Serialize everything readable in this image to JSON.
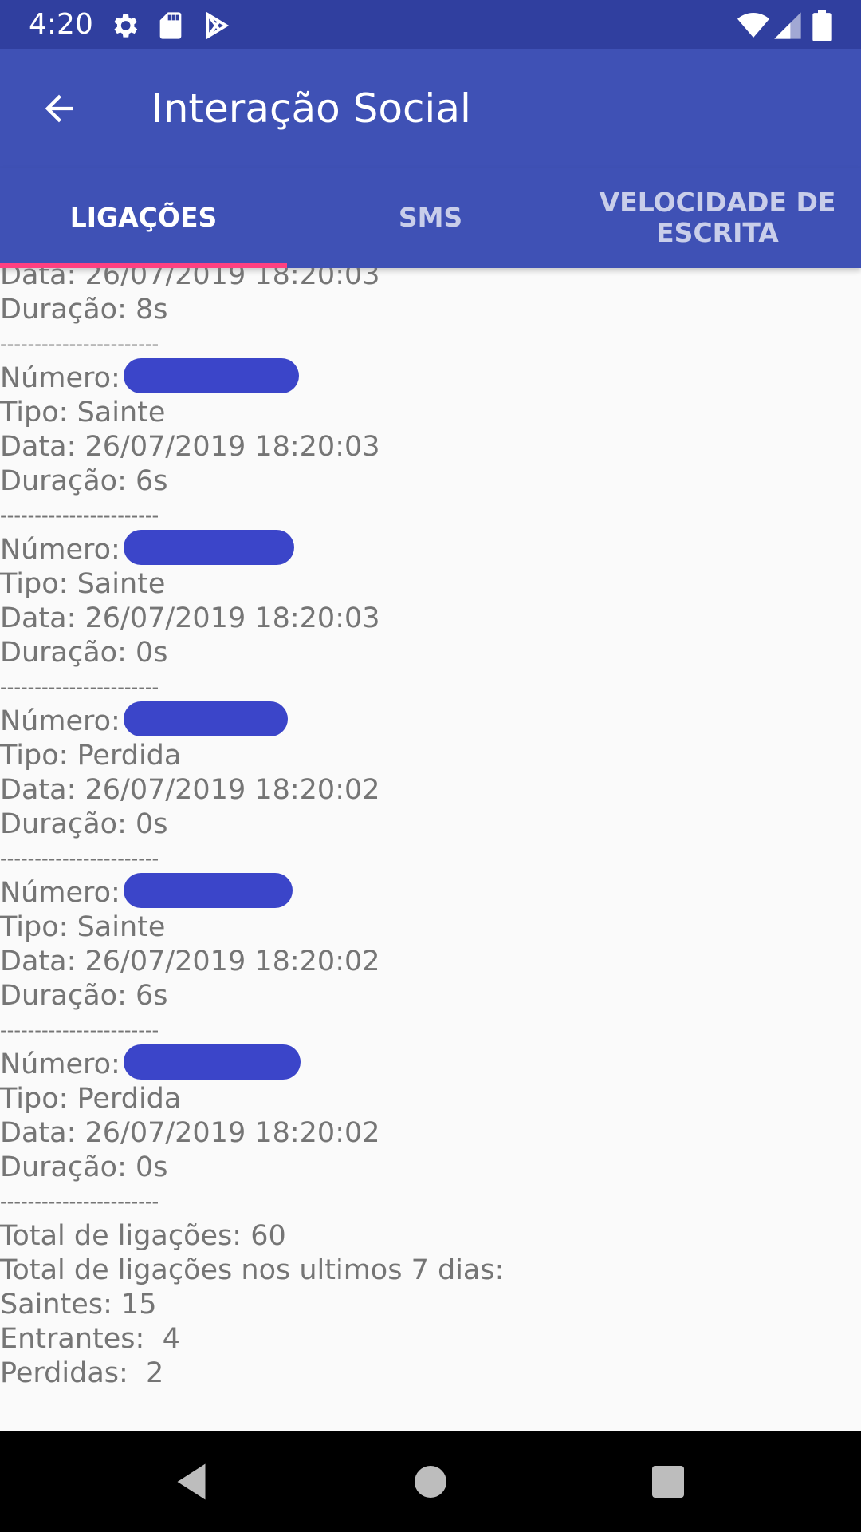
{
  "status_bar": {
    "time": "4:20",
    "icons": [
      "gear-icon",
      "sd-card-icon",
      "play-store-icon",
      "wifi-icon",
      "cellular-signal-icon",
      "battery-icon"
    ]
  },
  "app_bar": {
    "title": "Interação Social",
    "back_icon": "arrow-back-icon"
  },
  "tabs": [
    {
      "label": "LIGAÇÕES",
      "active": true
    },
    {
      "label": "SMS",
      "active": false
    },
    {
      "label": "VELOCIDADE DE ESCRITA",
      "active": false
    }
  ],
  "colors": {
    "status_bar": "#303f9f",
    "app_bar": "#3f51b5",
    "tab_indicator": "#ff4081",
    "redaction": "#3b45c9"
  },
  "log": {
    "first_partial": {
      "data": "Data: 26/07/2019 18:20:03",
      "duracao": "Duração: 8s"
    },
    "separator": "-----------------------",
    "entries": [
      {
        "numero": "Número:",
        "tipo": "Tipo: Sainte",
        "data": "Data: 26/07/2019 18:20:03",
        "duracao": "Duração: 6s"
      },
      {
        "numero": "Número:",
        "tipo": "Tipo: Sainte",
        "data": "Data: 26/07/2019 18:20:03",
        "duracao": "Duração: 0s"
      },
      {
        "numero": "Número:",
        "tipo": "Tipo: Perdida",
        "data": "Data: 26/07/2019 18:20:02",
        "duracao": "Duração: 0s"
      },
      {
        "numero": "Número:",
        "tipo": "Tipo: Sainte",
        "data": "Data: 26/07/2019 18:20:02",
        "duracao": "Duração: 6s"
      },
      {
        "numero": "Número:",
        "tipo": "Tipo: Perdida",
        "data": "Data: 26/07/2019 18:20:02",
        "duracao": "Duração: 0s"
      }
    ],
    "summary": {
      "total": "Total de ligações: 60",
      "total_7_days": "Total de ligações nos ultimos 7 dias:",
      "saintes": "Saintes: 15",
      "entrantes": "Entrantes:  4",
      "perdidas": "Perdidas:  2"
    }
  },
  "nav_bar": {
    "icons": [
      "back-triangle-icon",
      "home-circle-icon",
      "recents-square-icon"
    ]
  }
}
